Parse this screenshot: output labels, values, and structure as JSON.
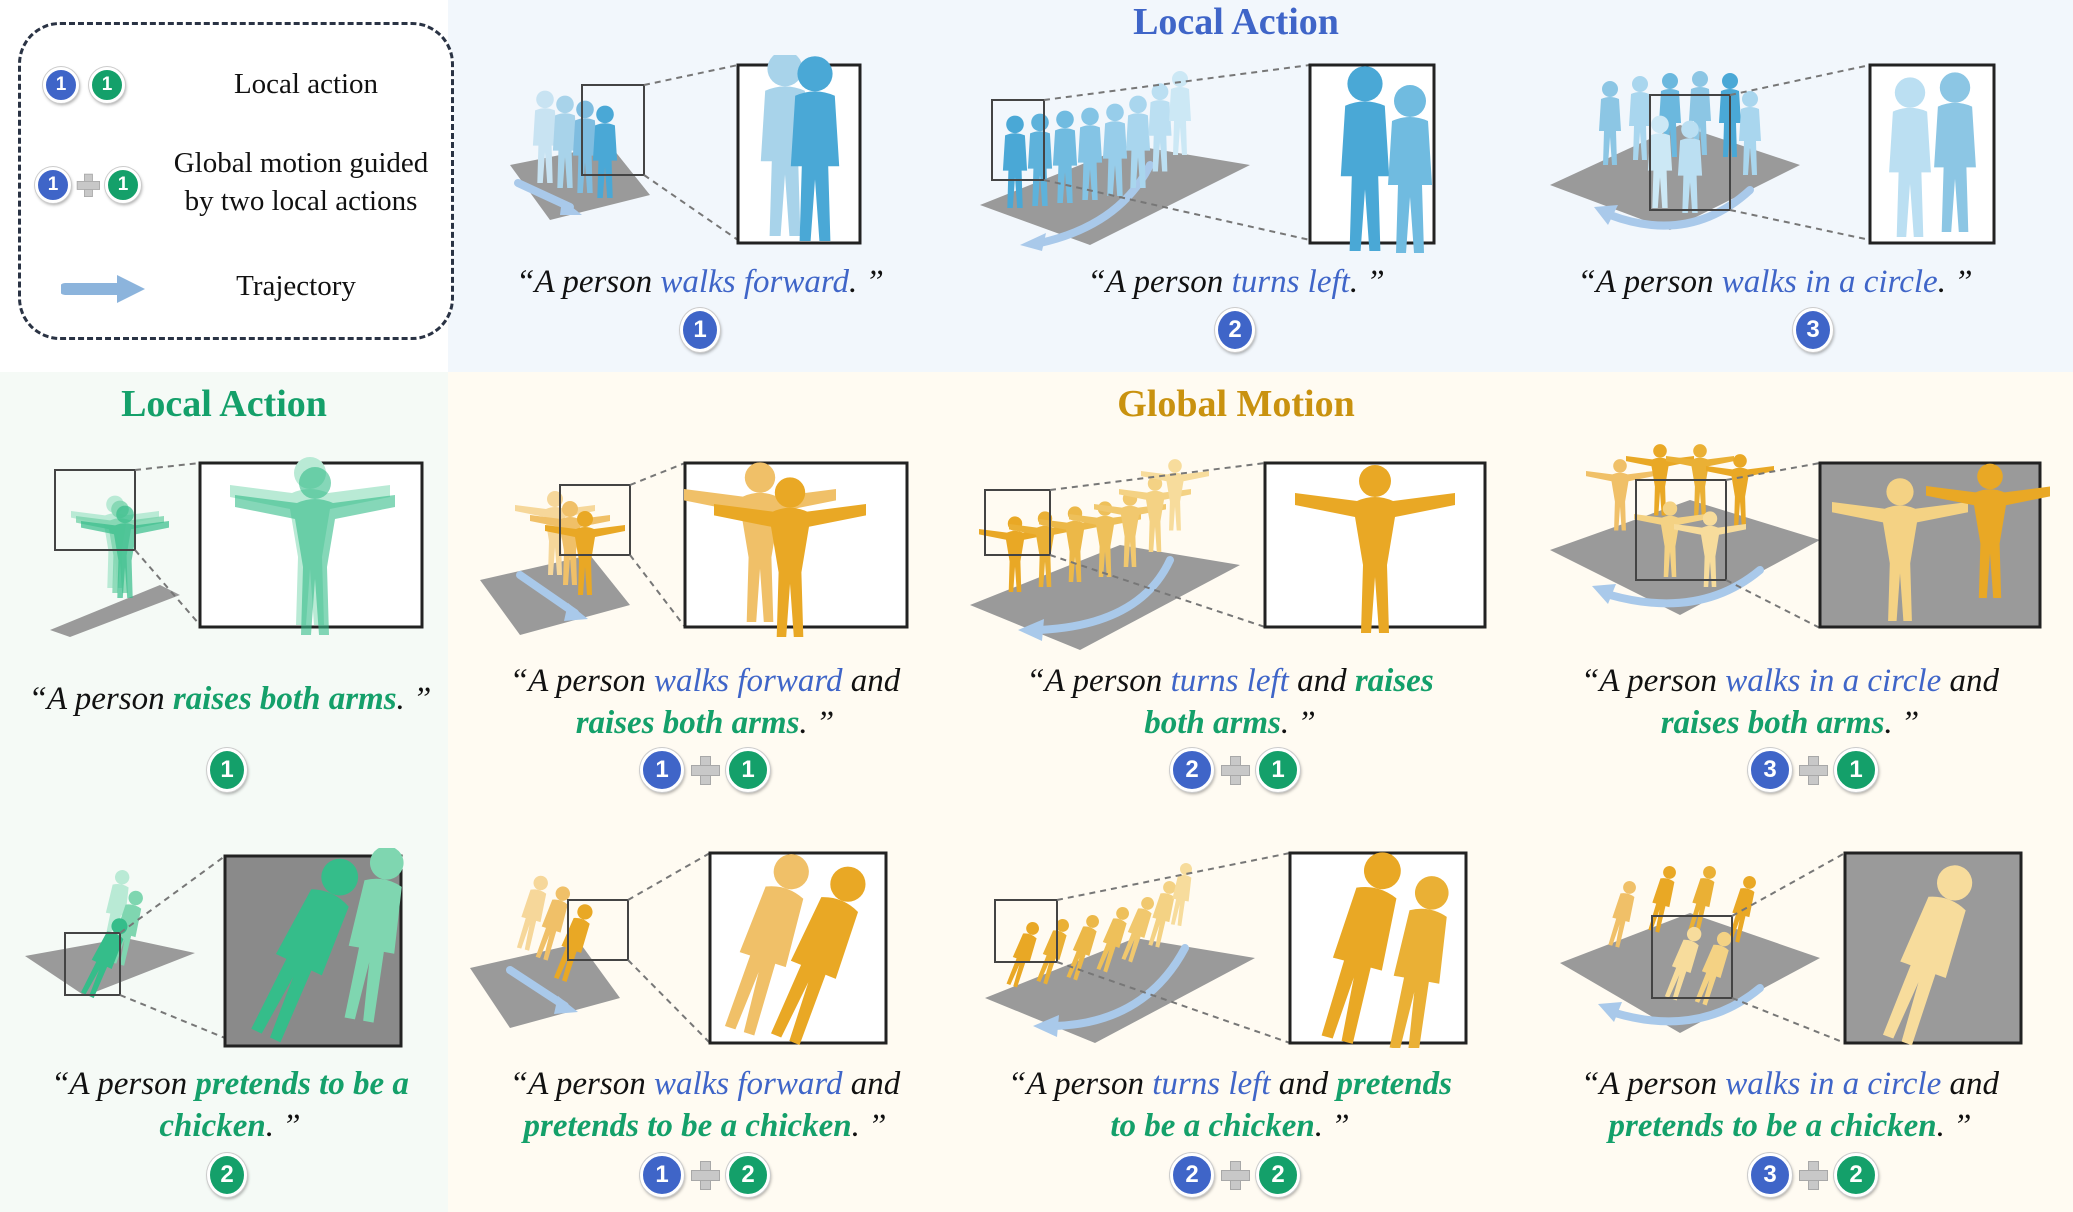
{
  "headings": {
    "local_action_top": "Local Action",
    "local_action_left": "Local Action",
    "global_motion": "Global Motion"
  },
  "legend": {
    "local_action": "Local action",
    "global_motion_line1": "Global motion guided",
    "global_motion_line2": "by two local actions",
    "trajectory": "Trajectory"
  },
  "badge_labels": {
    "one": "1",
    "two": "2",
    "three": "3"
  },
  "top_row": [
    {
      "prefix": "“A person ",
      "action": "walks forward",
      "suffix": ". ”",
      "badge": "1"
    },
    {
      "prefix": "“A person ",
      "action": "turns left",
      "suffix": ". ”",
      "badge": "2"
    },
    {
      "prefix": "“A person ",
      "action": "walks in a circle",
      "suffix": ". ”",
      "badge": "3"
    }
  ],
  "left_col": [
    {
      "prefix": "“A person ",
      "action": "raises both arms",
      "suffix": ". ”",
      "badge": "1"
    },
    {
      "prefix": "“A person ",
      "action_line1": "pretends to be a",
      "action_line2": "chicken",
      "suffix": ". ”",
      "badge": "2"
    }
  ],
  "row2": [
    {
      "p1": "“A person ",
      "blue": "walks forward",
      "mid": " and",
      "green": "raises both arms",
      "end": ". ”",
      "b1": "1",
      "b2": "1"
    },
    {
      "p1": "“A person ",
      "blue": "turns left",
      "mid": " and ",
      "green_a": "raises",
      "green_b": "both arms",
      "end": ". ”",
      "b1": "2",
      "b2": "1"
    },
    {
      "p1": "“A person ",
      "blue": "walks in a circle",
      "mid": " and",
      "green": "raises both arms",
      "end": ". ”",
      "b1": "3",
      "b2": "1"
    }
  ],
  "row3": [
    {
      "p1": "“A person ",
      "blue": "walks forward",
      "mid": " and",
      "green": "pretends to be a chicken",
      "end": ". ”",
      "b1": "1",
      "b2": "2"
    },
    {
      "p1": "“A person ",
      "blue": "turns left",
      "mid": " and ",
      "green_a": "pretends",
      "green_b": "to be a chicken",
      "end": ". ”",
      "b1": "2",
      "b2": "2"
    },
    {
      "p1": "“A person ",
      "blue": "walks in a circle",
      "mid": " and",
      "green": "pretends to be a chicken",
      "end": ". ”",
      "b1": "3",
      "b2": "2"
    }
  ],
  "colors": {
    "blue": "#3f65c8",
    "green": "#14a06a",
    "gold": "#c9920f",
    "figure_blue": "#4aa8d6",
    "figure_green": "#35bd8a",
    "figure_gold": "#e9a825",
    "floor": "#9a9a9a"
  }
}
